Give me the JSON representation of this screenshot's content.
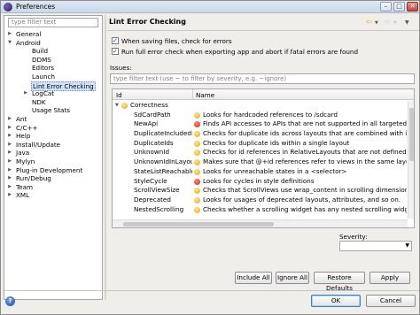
{
  "window": {
    "title": "Preferences"
  },
  "left": {
    "filter_placeholder": "type filter text",
    "tree": [
      {
        "label": "General",
        "level": 0,
        "twisty": "▶"
      },
      {
        "label": "Android",
        "level": 0,
        "twisty": "▼"
      },
      {
        "label": "Build",
        "level": 1,
        "twisty": ""
      },
      {
        "label": "DDMS",
        "level": 1,
        "twisty": ""
      },
      {
        "label": "Editors",
        "level": 1,
        "twisty": ""
      },
      {
        "label": "Launch",
        "level": 1,
        "twisty": ""
      },
      {
        "label": "Lint Error Checking",
        "level": 1,
        "twisty": "",
        "selected": true
      },
      {
        "label": "LogCat",
        "level": 1,
        "twisty": "▶"
      },
      {
        "label": "NDK",
        "level": 1,
        "twisty": ""
      },
      {
        "label": "Usage Stats",
        "level": 1,
        "twisty": ""
      },
      {
        "label": "Ant",
        "level": 0,
        "twisty": "▶"
      },
      {
        "label": "C/C++",
        "level": 0,
        "twisty": "▶"
      },
      {
        "label": "Help",
        "level": 0,
        "twisty": "▶"
      },
      {
        "label": "Install/Update",
        "level": 0,
        "twisty": "▶"
      },
      {
        "label": "Java",
        "level": 0,
        "twisty": "▶"
      },
      {
        "label": "Mylyn",
        "level": 0,
        "twisty": "▶"
      },
      {
        "label": "Plug-in Development",
        "level": 0,
        "twisty": "▶"
      },
      {
        "label": "Run/Debug",
        "level": 0,
        "twisty": "▶"
      },
      {
        "label": "Team",
        "level": 0,
        "twisty": "▶"
      },
      {
        "label": "XML",
        "level": 0,
        "twisty": "▶"
      }
    ]
  },
  "page": {
    "title": "Lint Error Checking",
    "check_on_save": "When saving files, check for errors",
    "check_on_export": "Run full error check when exporting app and abort if fatal errors are found",
    "issues_label": "Issues:",
    "issues_filter_placeholder": "type filter text (use ~ to filter by severity, e.g. ~ignore)",
    "col_id": "Id",
    "col_name": "Name",
    "category": "Correctness",
    "rows": [
      {
        "id": "SdCardPath",
        "severity": "warning",
        "name": "Looks for hardcoded references to /sdcard"
      },
      {
        "id": "NewApi",
        "severity": "error",
        "name": "Finds API accesses to APIs that are not supported in all targeted API ..."
      },
      {
        "id": "DuplicateIncludedId",
        "severity": "warning",
        "name": "Checks for duplicate ids across layouts that are combined with inclu..."
      },
      {
        "id": "DuplicateIds",
        "severity": "warning",
        "name": "Checks for duplicate ids within a single layout"
      },
      {
        "id": "UnknownId",
        "severity": "warning",
        "name": "Checks for id references in RelativeLayouts that are not defined else..."
      },
      {
        "id": "UnknownIdInLayout",
        "severity": "warning",
        "name": "Makes sure that @+id references refer to views in the same layout"
      },
      {
        "id": "StateListReachable",
        "severity": "warning",
        "name": "Looks for unreachable states in a <selector>"
      },
      {
        "id": "StyleCycle",
        "severity": "error",
        "name": "Looks for cycles in style definitions"
      },
      {
        "id": "ScrollViewSize",
        "severity": "warning",
        "name": "Checks that ScrollViews use wrap_content in scrolling dimension"
      },
      {
        "id": "Deprecated",
        "severity": "warning",
        "name": "Looks for usages of deprecated layouts, attributes, and so on."
      },
      {
        "id": "NestedScrolling",
        "severity": "warning",
        "name": "Checks whether a scrolling widget has any nested scrolling widgets ..."
      }
    ],
    "severity_label": "Severity:",
    "btn_include_all": "Include All",
    "btn_ignore_all": "Ignore All",
    "btn_restore": "Restore Defaults",
    "btn_apply": "Apply"
  },
  "footer": {
    "ok": "OK",
    "cancel": "Cancel",
    "help": "?"
  },
  "colors": {
    "selection": "#cfe2f9",
    "warning": "#e6a10f",
    "error": "#d4260f"
  }
}
